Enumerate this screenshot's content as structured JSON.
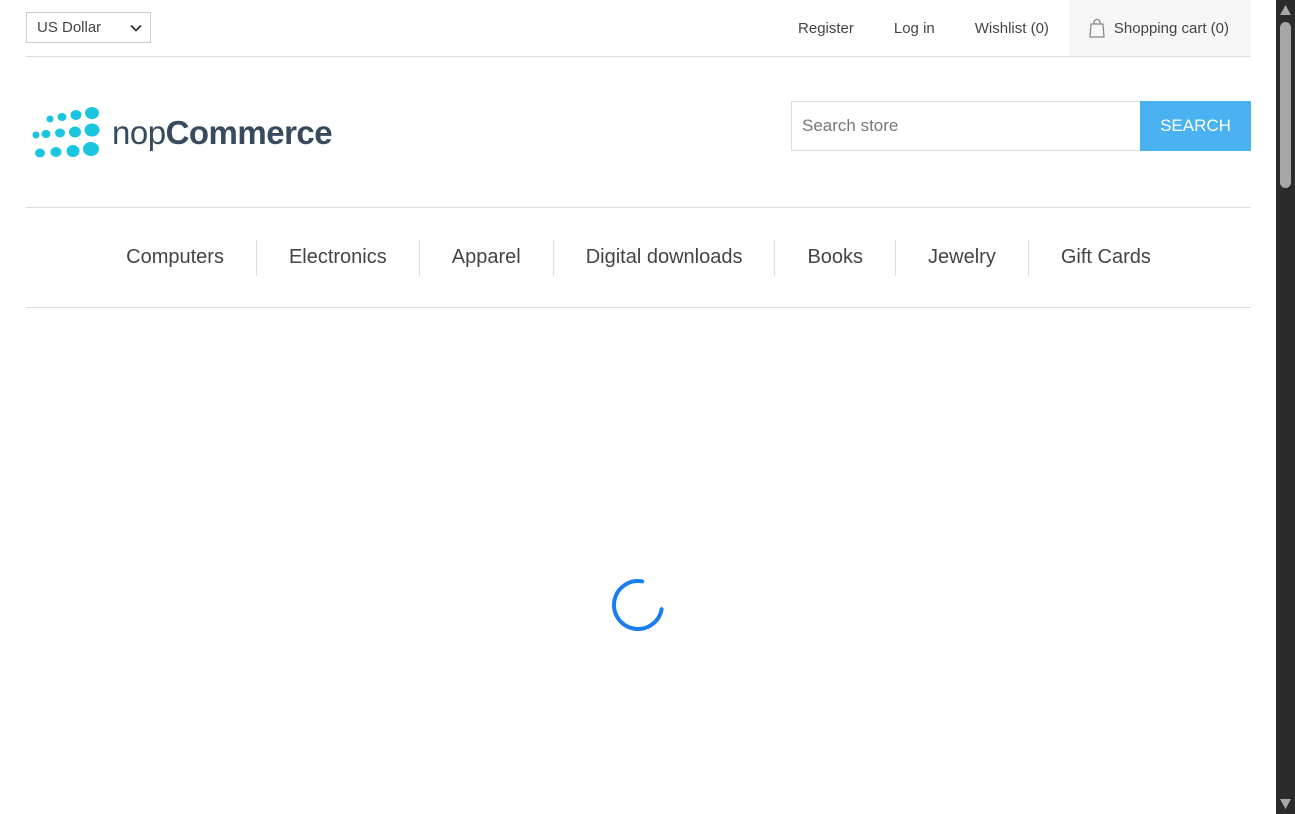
{
  "header": {
    "currency": {
      "selected": "US Dollar"
    },
    "links": {
      "register": "Register",
      "login": "Log in",
      "wishlist": "Wishlist (0)",
      "cart": "Shopping cart (0)"
    }
  },
  "logo": {
    "light": "nop",
    "bold": "Commerce"
  },
  "search": {
    "placeholder": "Search store",
    "button_label": "SEARCH"
  },
  "menu": {
    "items": [
      "Computers",
      "Electronics",
      "Apparel",
      "Digital downloads",
      "Books",
      "Jewelry",
      "Gift Cards"
    ]
  },
  "colors": {
    "accent": "#4ab2f1",
    "logo_dots": "#1ac5e0",
    "spinner": "#1b7ef0"
  },
  "icons": {
    "cart": "shopping-bag-icon",
    "currency_dropdown": "chevron-down-icon",
    "loading": "loading-spinner-icon"
  }
}
